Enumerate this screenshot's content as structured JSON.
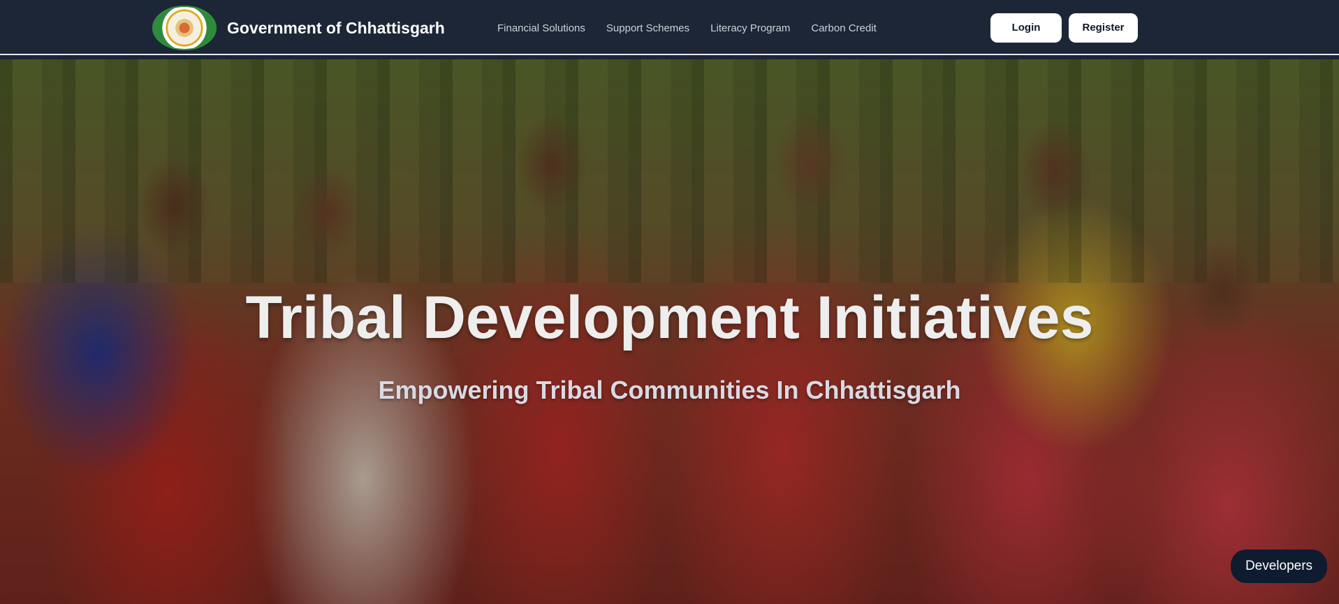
{
  "header": {
    "brand": "Government of Chhattisgarh",
    "logo_icon": "chhattisgarh-emblem-icon",
    "nav": [
      {
        "label": "Financial Solutions"
      },
      {
        "label": "Support Schemes"
      },
      {
        "label": "Literacy Program"
      },
      {
        "label": "Carbon Credit"
      }
    ],
    "login_label": "Login",
    "register_label": "Register"
  },
  "hero": {
    "title": "Tribal Development Initiatives",
    "subtitle": "Empowering Tribal Communities In Chhattisgarh",
    "image_description_icon": "tribal-women-photo"
  },
  "floating": {
    "developers_label": "Developers"
  },
  "colors": {
    "navbar": "#1d2636",
    "button_bg": "#ffffff",
    "developers_bg": "#0f1b2e"
  }
}
